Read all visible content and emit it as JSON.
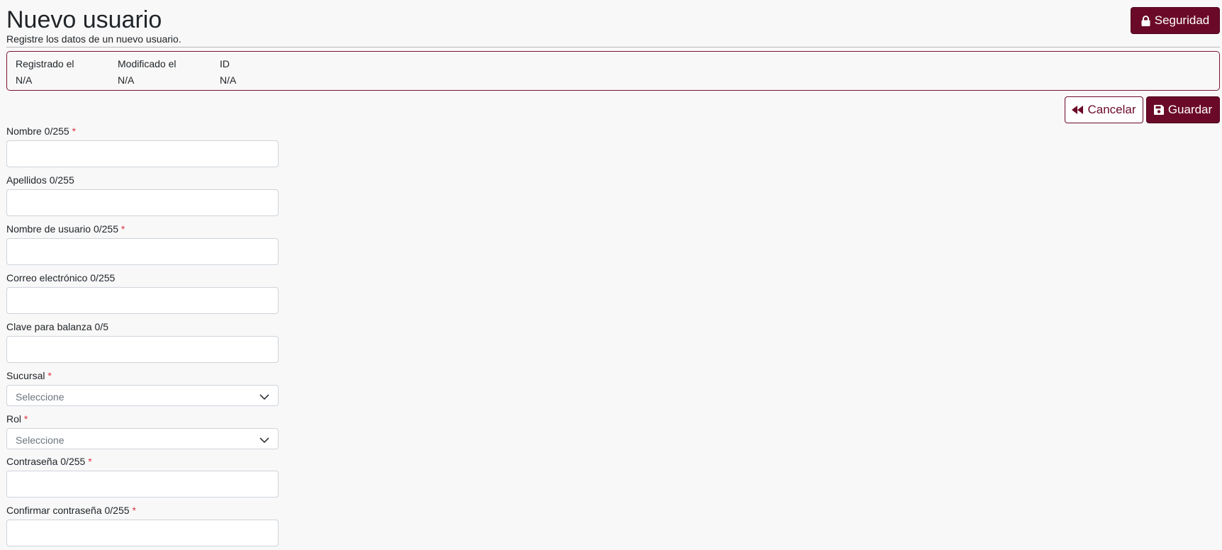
{
  "header": {
    "title": "Nuevo usuario",
    "subtitle": "Registre los datos de un nuevo usuario.",
    "security_label": "Seguridad"
  },
  "meta": [
    {
      "label": "Registrado el",
      "value": "N/A"
    },
    {
      "label": "Modificado el",
      "value": "N/A"
    },
    {
      "label": "ID",
      "value": "N/A"
    }
  ],
  "actions": {
    "cancel_label": "Cancelar",
    "save_label": "Guardar"
  },
  "form": {
    "nombre": {
      "label": "Nombre 0/255",
      "required": "*",
      "value": ""
    },
    "apellidos": {
      "label": "Apellidos 0/255",
      "value": ""
    },
    "usuario": {
      "label": "Nombre de usuario 0/255",
      "required": "*",
      "value": ""
    },
    "correo": {
      "label": "Correo electrónico 0/255",
      "value": ""
    },
    "clave_balanza": {
      "label": "Clave para balanza 0/5",
      "value": ""
    },
    "sucursal": {
      "label": "Sucursal",
      "required": "*",
      "selected": "Seleccione"
    },
    "rol": {
      "label": "Rol",
      "required": "*",
      "selected": "Seleccione"
    },
    "contrasena": {
      "label": "Contraseña 0/255",
      "required": "*",
      "value": ""
    },
    "confirmar": {
      "label": "Confirmar contraseña 0/255",
      "required": "*",
      "value": ""
    }
  },
  "colors": {
    "primary": "#6b0a28",
    "required": "#dc3545",
    "background": "#f8f8f8"
  },
  "icons": {
    "security": "lock-icon",
    "cancel": "backward-icon",
    "save": "floppy-disk-icon",
    "select": "chevron-down-icon"
  }
}
